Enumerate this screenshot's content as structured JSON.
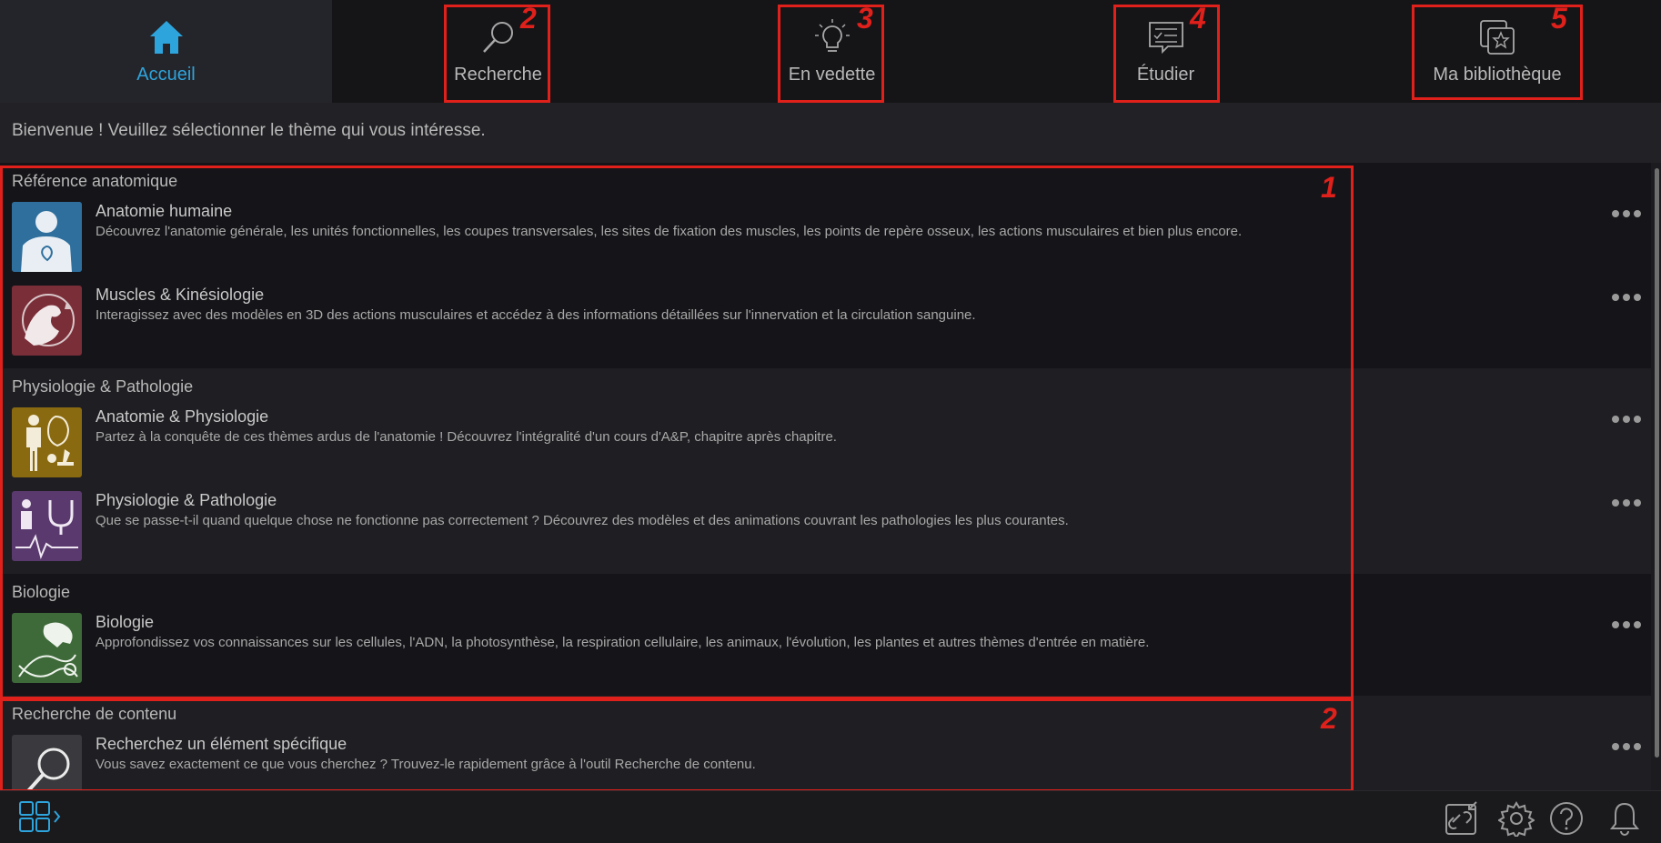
{
  "nav": {
    "items": [
      {
        "label": "Accueil",
        "icon": "home-icon",
        "active": true
      },
      {
        "label": "Recherche",
        "icon": "search-icon"
      },
      {
        "label": "En vedette",
        "icon": "lightbulb-icon"
      },
      {
        "label": "Étudier",
        "icon": "study-card-icon"
      },
      {
        "label": "Ma bibliothèque",
        "icon": "library-star-icon"
      }
    ]
  },
  "annotations": [
    "2",
    "3",
    "4",
    "5",
    "1",
    "2"
  ],
  "welcome": "Bienvenue ! Veuillez sélectionner le thème qui vous intéresse.",
  "sections": [
    {
      "title": "Référence anatomique",
      "items": [
        {
          "title": "Anatomie humaine",
          "desc": "Découvrez l'anatomie générale, les unités fonctionnelles, les coupes transversales, les sites de fixation des muscles, les points de repère osseux, les actions musculaires et bien plus encore.",
          "thumb_color": "#2e6f9e"
        },
        {
          "title": "Muscles & Kinésiologie",
          "desc": "Interagissez avec des modèles en 3D des actions musculaires et accédez à des informations détaillées sur l'innervation et la circulation sanguine.",
          "thumb_color": "#7a2e38"
        }
      ]
    },
    {
      "title": "Physiologie & Pathologie",
      "items": [
        {
          "title": "Anatomie & Physiologie",
          "desc": "Partez à la conquête de ces thèmes ardus de l'anatomie ! Découvrez l'intégralité d'un cours d'A&P, chapitre après chapitre.",
          "thumb_color": "#8a6a10"
        },
        {
          "title": "Physiologie & Pathologie",
          "desc": "Que se passe-t-il quand quelque chose ne fonctionne pas correctement ? Découvrez des modèles et des animations couvrant les pathologies les plus courantes.",
          "thumb_color": "#5a3a6e"
        }
      ]
    },
    {
      "title": "Biologie",
      "items": [
        {
          "title": "Biologie",
          "desc": "Approfondissez vos connaissances sur les cellules, l'ADN, la photosynthèse, la respiration cellulaire, les animaux, l'évolution, les plantes et autres thèmes d'entrée en matière.",
          "thumb_color": "#3e6a3a"
        }
      ]
    },
    {
      "title": "Recherche de contenu",
      "items": [
        {
          "title": "Recherchez un élément spécifique",
          "desc": "Vous savez exactement ce que vous cherchez ? Trouvez-le rapidement grâce à l'outil Recherche de contenu.",
          "thumb_color": "#3a3a3e"
        }
      ]
    }
  ],
  "bottombar": {
    "icons": [
      "grid-menu-icon",
      "link-transfer-icon",
      "settings-icon",
      "help-icon",
      "notification-bell-icon"
    ]
  },
  "colors": {
    "accent": "#2ea4dc",
    "annotation": "#e0201b"
  }
}
